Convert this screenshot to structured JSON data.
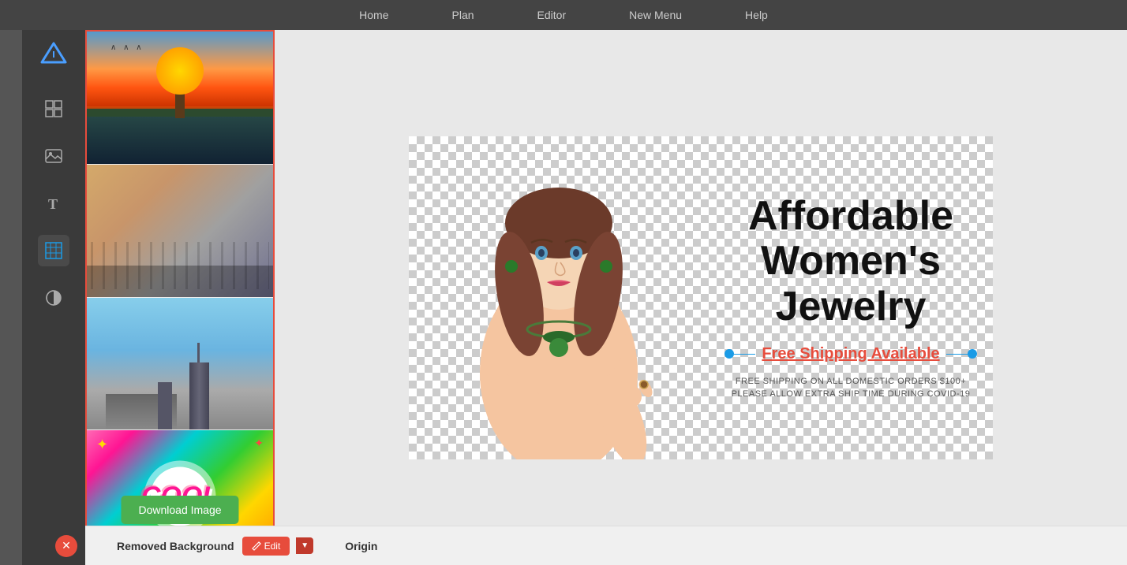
{
  "topbar": {
    "nav_items": [
      "Home",
      "Plan",
      "Editor",
      "New Menu",
      "Help"
    ]
  },
  "sidebar": {
    "logo_alt": "App Logo",
    "icons": [
      {
        "name": "logo-icon",
        "symbol": "△",
        "label": "Logo"
      },
      {
        "name": "grid-icon",
        "symbol": "⊞",
        "label": "Grid"
      },
      {
        "name": "image-icon",
        "symbol": "🖼",
        "label": "Images"
      },
      {
        "name": "text-icon",
        "symbol": "T",
        "label": "Text"
      },
      {
        "name": "pattern-icon",
        "symbol": "⊟",
        "label": "Pattern"
      },
      {
        "name": "adjust-icon",
        "symbol": "◑",
        "label": "Adjust"
      }
    ]
  },
  "image_panel": {
    "thumbnails": [
      {
        "id": "sunset",
        "label": "Sunset dock"
      },
      {
        "id": "crowd",
        "label": "City crowd"
      },
      {
        "id": "buildings",
        "label": "City buildings"
      },
      {
        "id": "cool",
        "label": "Cool comic"
      }
    ],
    "download_button": "Download Image"
  },
  "banner": {
    "title": "Affordable Women's Jewelry",
    "shipping_label": "Free Shipping Available",
    "small_text_line1": "FREE SHIPPING ON ALL DOMESTIC ORDERS $100+",
    "small_text_line2": "PLEASE ALLOW EXTRA SHIP TIME DURING COVID-19"
  },
  "bottom_bar": {
    "removed_bg_label": "Removed Background",
    "edit_button": "Edit",
    "origin_label": "Origin"
  }
}
